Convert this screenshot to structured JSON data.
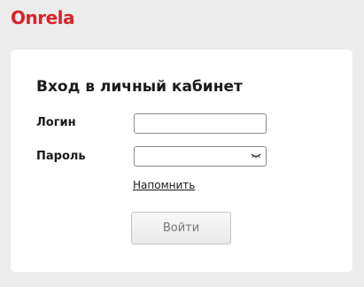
{
  "brand": {
    "logo_text": "Onrela",
    "color": "#d8232a"
  },
  "login_form": {
    "title": "Вход в личный кабинет",
    "login_label": "Логин",
    "login_value": "",
    "password_label": "Пароль",
    "password_value": "",
    "password_toggle_icon": "eye-closed-icon",
    "remind_link": "Напомнить",
    "submit_label": "Войти"
  }
}
